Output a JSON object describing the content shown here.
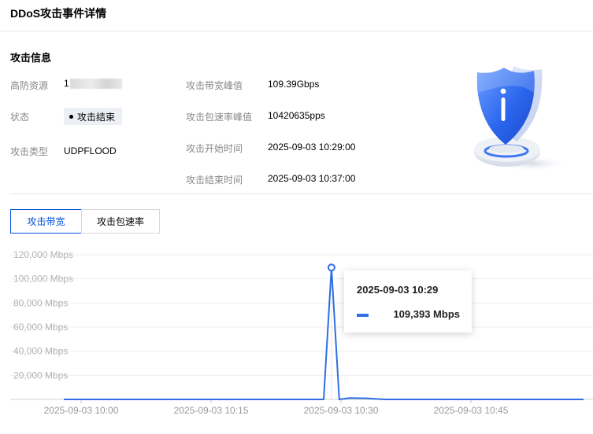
{
  "header": {
    "title": "DDoS攻击事件详情"
  },
  "attack_info": {
    "section_title": "攻击信息",
    "labels": {
      "resource": "高防资源",
      "status": "状态",
      "type": "攻击类型",
      "bw_peak": "攻击带宽峰值",
      "pps_peak": "攻击包速率峰值",
      "start_time": "攻击开始时间",
      "end_time": "攻击结束时间"
    },
    "values": {
      "resource_visible": "1",
      "status": "攻击结束",
      "type": "UDPFLOOD",
      "bw_peak": "109.39Gbps",
      "pps_peak": "10420635pps",
      "start_time": "2025-09-03 10:29:00",
      "end_time": "2025-09-03 10:37:00"
    }
  },
  "tabs": [
    {
      "label": "攻击带宽",
      "active": true
    },
    {
      "label": "攻击包速率",
      "active": false
    }
  ],
  "tooltip": {
    "time": "2025-09-03 10:29",
    "value": "109,393 Mbps"
  },
  "chart_data": {
    "type": "line",
    "ylim": [
      0,
      120000
    ],
    "y_ticks": [
      20000,
      40000,
      60000,
      80000,
      100000,
      120000
    ],
    "y_tick_labels": [
      "20,000 Mbps",
      "40,000 Mbps",
      "60,000 Mbps",
      "80,000 Mbps",
      "100,000 Mbps",
      "120,000 Mbps"
    ],
    "x_tick_labels": [
      "2025-09-03 10:00",
      "2025-09-03 10:15",
      "2025-09-03 10:30",
      "2025-09-03 10:45"
    ],
    "x_ticks_min": [
      0,
      15,
      30,
      45
    ],
    "xlim_min": [
      -2,
      58
    ],
    "series": [
      {
        "color": "#2f6ee3",
        "points": [
          [
            -2,
            0
          ],
          [
            26,
            0
          ],
          [
            28,
            0
          ],
          [
            28.9,
            109393
          ],
          [
            29.8,
            0
          ],
          [
            31,
            1200
          ],
          [
            33,
            900
          ],
          [
            35,
            0
          ],
          [
            58,
            0
          ]
        ]
      }
    ],
    "highlight": {
      "x": 28.9,
      "y": 109393
    }
  },
  "colors": {
    "accent": "#0052d9",
    "series": "#2f6ee3",
    "label": "#888888"
  },
  "icons": {
    "illustration": "shield-info-icon"
  }
}
